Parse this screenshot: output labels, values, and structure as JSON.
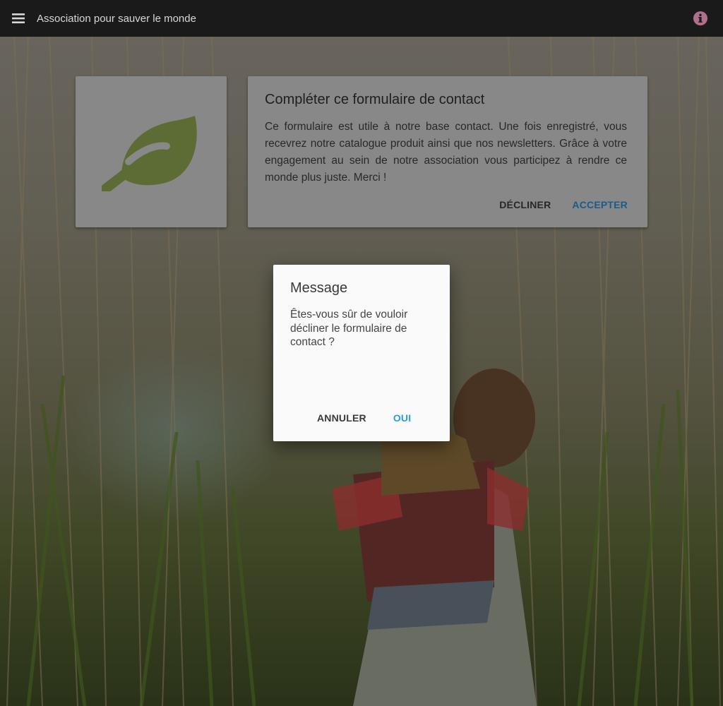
{
  "appbar": {
    "title": "Association pour sauver le monde",
    "menu_icon": "hamburger-menu-icon",
    "info_icon": "info-circle-icon"
  },
  "card_image": {
    "icon": "leaf-icon",
    "icon_color": "#8a9f4e"
  },
  "card": {
    "title": "Compléter ce formulaire de contact",
    "body": "Ce formulaire est utile à notre base contact. Une fois enregistré, vous recevrez notre catalogue produit ainsi que nos newsletters. Grâce à votre engagement au sein de notre association vous participez à rendre ce monde plus juste. Merci !",
    "decline_label": "DÉCLINER",
    "accept_label": "ACCEPTER"
  },
  "dialog": {
    "title": "Message",
    "message": "Êtes-vous sûr de vouloir décliner le formulaire de contact ?",
    "cancel_label": "ANNULER",
    "ok_label": "OUI"
  },
  "colors": {
    "appbar": "#1a1a1a",
    "accent": "#2a86cc",
    "leaf": "#8a9f4e"
  }
}
